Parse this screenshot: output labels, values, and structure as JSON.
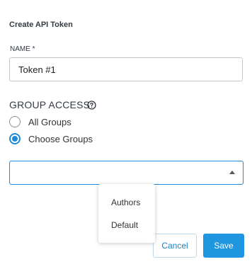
{
  "dialog": {
    "title": "Create API Token"
  },
  "name_field": {
    "label": "NAME *",
    "value": "Token #1"
  },
  "group_access": {
    "heading": "GROUP ACCESS",
    "help_icon": "question-circle-icon",
    "options": [
      {
        "label": "All Groups",
        "selected": false
      },
      {
        "label": "Choose Groups",
        "selected": true
      }
    ]
  },
  "groups_select": {
    "value": "",
    "open": true,
    "options": [
      "Authors",
      "Default"
    ]
  },
  "buttons": {
    "cancel": "Cancel",
    "save": "Save"
  },
  "colors": {
    "accent": "#2196e0",
    "radio_selected": "#1d8ad8",
    "text": "#333a44"
  }
}
